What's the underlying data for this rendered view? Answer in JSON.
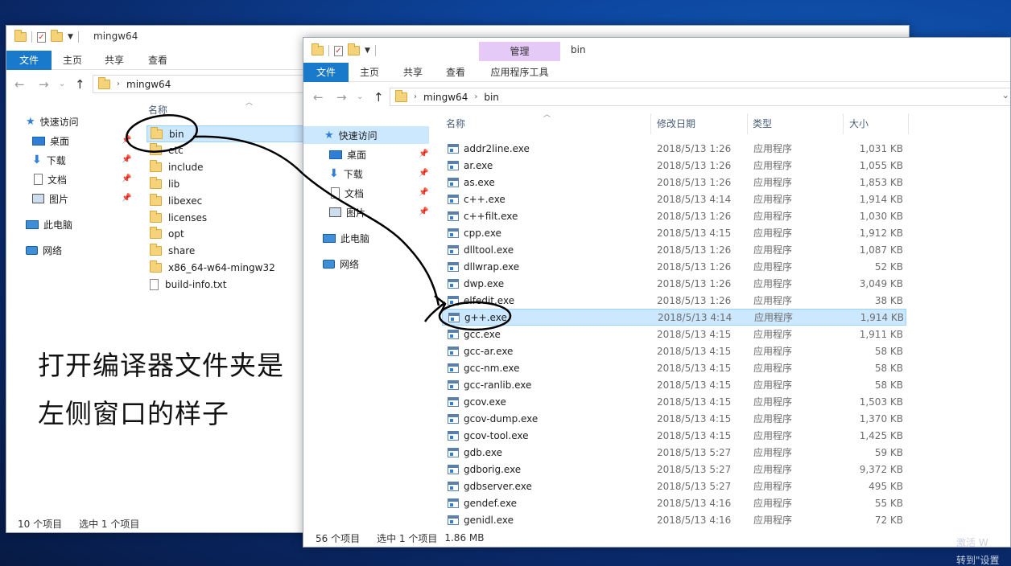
{
  "left_window": {
    "title": "mingw64",
    "tabs": [
      "文件",
      "主页",
      "共享",
      "查看"
    ],
    "breadcrumb": [
      "mingw64"
    ],
    "nav": [
      {
        "label": "快速访问",
        "icon": "star-icon"
      },
      {
        "label": "桌面",
        "icon": "desktop-icon",
        "pinned": true
      },
      {
        "label": "下载",
        "icon": "download-icon",
        "pinned": true
      },
      {
        "label": "文档",
        "icon": "document-icon",
        "pinned": true
      },
      {
        "label": "图片",
        "icon": "pictures-icon",
        "pinned": true
      },
      {
        "label": "此电脑",
        "icon": "computer-icon"
      },
      {
        "label": "网络",
        "icon": "network-icon"
      }
    ],
    "column_name": "名称",
    "items": [
      "bin",
      "etc",
      "include",
      "lib",
      "libexec",
      "licenses",
      "opt",
      "share",
      "x86_64-w64-mingw32",
      "build-info.txt"
    ],
    "status_count": "10 个项目",
    "status_selected": "选中 1 个项目"
  },
  "right_window": {
    "title": "bin",
    "manage_tab": "管理",
    "app_tools_tab": "应用程序工具",
    "tabs": [
      "文件",
      "主页",
      "共享",
      "查看"
    ],
    "breadcrumb": [
      "mingw64",
      "bin"
    ],
    "nav": [
      {
        "label": "快速访问",
        "icon": "star-icon"
      },
      {
        "label": "桌面",
        "icon": "desktop-icon",
        "pinned": true
      },
      {
        "label": "下载",
        "icon": "download-icon",
        "pinned": true
      },
      {
        "label": "文档",
        "icon": "document-icon",
        "pinned": true
      },
      {
        "label": "图片",
        "icon": "pictures-icon",
        "pinned": true
      },
      {
        "label": "此电脑",
        "icon": "computer-icon"
      },
      {
        "label": "网络",
        "icon": "network-icon"
      }
    ],
    "columns": [
      "名称",
      "修改日期",
      "类型",
      "大小"
    ],
    "files": [
      {
        "name": "addr2line.exe",
        "date": "2018/5/13 1:26",
        "type": "应用程序",
        "size": "1,031 KB"
      },
      {
        "name": "ar.exe",
        "date": "2018/5/13 1:26",
        "type": "应用程序",
        "size": "1,055 KB"
      },
      {
        "name": "as.exe",
        "date": "2018/5/13 1:26",
        "type": "应用程序",
        "size": "1,853 KB"
      },
      {
        "name": "c++.exe",
        "date": "2018/5/13 4:14",
        "type": "应用程序",
        "size": "1,914 KB"
      },
      {
        "name": "c++filt.exe",
        "date": "2018/5/13 1:26",
        "type": "应用程序",
        "size": "1,030 KB"
      },
      {
        "name": "cpp.exe",
        "date": "2018/5/13 4:15",
        "type": "应用程序",
        "size": "1,912 KB"
      },
      {
        "name": "dlltool.exe",
        "date": "2018/5/13 1:26",
        "type": "应用程序",
        "size": "1,087 KB"
      },
      {
        "name": "dllwrap.exe",
        "date": "2018/5/13 1:26",
        "type": "应用程序",
        "size": "52 KB"
      },
      {
        "name": "dwp.exe",
        "date": "2018/5/13 1:26",
        "type": "应用程序",
        "size": "3,049 KB"
      },
      {
        "name": "elfedit.exe",
        "date": "2018/5/13 1:26",
        "type": "应用程序",
        "size": "38 KB"
      },
      {
        "name": "g++.exe",
        "date": "2018/5/13 4:14",
        "type": "应用程序",
        "size": "1,914 KB"
      },
      {
        "name": "gcc.exe",
        "date": "2018/5/13 4:15",
        "type": "应用程序",
        "size": "1,911 KB"
      },
      {
        "name": "gcc-ar.exe",
        "date": "2018/5/13 4:15",
        "type": "应用程序",
        "size": "58 KB"
      },
      {
        "name": "gcc-nm.exe",
        "date": "2018/5/13 4:15",
        "type": "应用程序",
        "size": "58 KB"
      },
      {
        "name": "gcc-ranlib.exe",
        "date": "2018/5/13 4:15",
        "type": "应用程序",
        "size": "58 KB"
      },
      {
        "name": "gcov.exe",
        "date": "2018/5/13 4:15",
        "type": "应用程序",
        "size": "1,503 KB"
      },
      {
        "name": "gcov-dump.exe",
        "date": "2018/5/13 4:15",
        "type": "应用程序",
        "size": "1,370 KB"
      },
      {
        "name": "gcov-tool.exe",
        "date": "2018/5/13 4:15",
        "type": "应用程序",
        "size": "1,425 KB"
      },
      {
        "name": "gdb.exe",
        "date": "2018/5/13 5:27",
        "type": "应用程序",
        "size": "59 KB"
      },
      {
        "name": "gdborig.exe",
        "date": "2018/5/13 5:27",
        "type": "应用程序",
        "size": "9,372 KB"
      },
      {
        "name": "gdbserver.exe",
        "date": "2018/5/13 5:27",
        "type": "应用程序",
        "size": "495 KB"
      },
      {
        "name": "gendef.exe",
        "date": "2018/5/13 4:16",
        "type": "应用程序",
        "size": "55 KB"
      },
      {
        "name": "genidl.exe",
        "date": "2018/5/13 4:16",
        "type": "应用程序",
        "size": "72 KB"
      }
    ],
    "status_count": "56 个项目",
    "status_selected": "选中 1 个项目",
    "status_size": "1.86 MB"
  },
  "annotation": {
    "line1": "打开编译器文件夹是",
    "line2": "左侧窗口的样子"
  },
  "watermark": {
    "line1": "激活 W",
    "line2": "转到\"设置"
  },
  "colors": {
    "file_tab": "#1979ca",
    "selection": "#cce8ff",
    "manage_tab": "#e5c9f7",
    "folder": "#f5d37a"
  }
}
